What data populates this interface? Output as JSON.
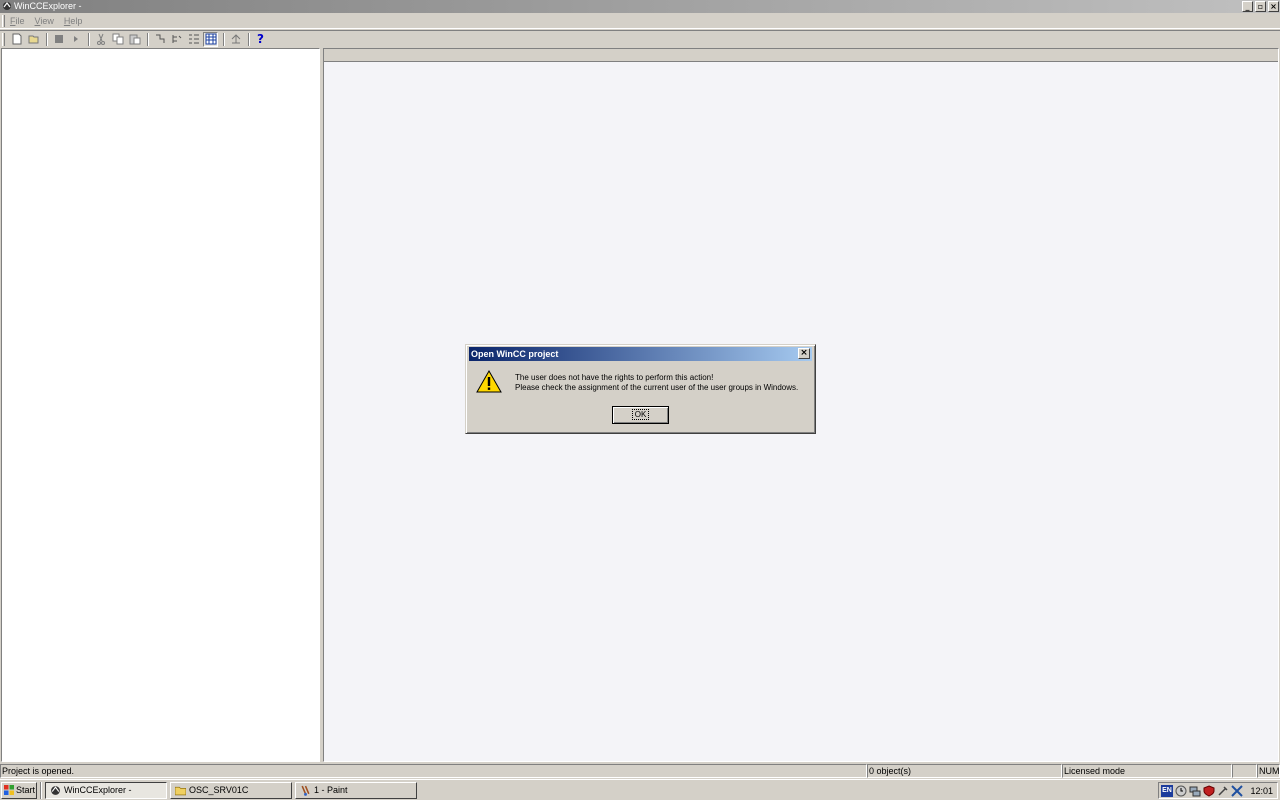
{
  "window": {
    "title": "WinCCExplorer -",
    "buttons": {
      "minimize": "_",
      "maximize": "▫",
      "close": "×"
    }
  },
  "menu": {
    "items": [
      {
        "accel": "F",
        "rest": "ile"
      },
      {
        "accel": "V",
        "rest": "iew"
      },
      {
        "accel": "H",
        "rest": "elp"
      }
    ]
  },
  "toolbar": {
    "icons": [
      "new-icon",
      "open-icon",
      "stop-icon",
      "run-icon",
      "cut-icon",
      "copy-icon",
      "paste-icon",
      "properties-icon",
      "tree-icon",
      "list-icon",
      "details-icon",
      "up-icon",
      "help-icon"
    ],
    "help_label": "?"
  },
  "dialog": {
    "title": "Open WinCC project",
    "close_label": "×",
    "message_line1": "The user does not have the rights to perform this action!",
    "message_line2": "Please check the assignment of the current user of the user groups in Windows.",
    "ok_label": "OK"
  },
  "statusbar": {
    "message": "Project is opened.",
    "objects": "0 object(s)",
    "mode": "Licensed mode",
    "num": "NUM"
  },
  "taskbar": {
    "start_label": "Start",
    "tasks": [
      {
        "label": "WinCCExplorer -",
        "icon": "wincc-icon",
        "active": true
      },
      {
        "label": "OSC_SRV01C",
        "icon": "folder-icon",
        "active": false
      },
      {
        "label": "1 - Paint",
        "icon": "paint-icon",
        "active": false
      }
    ],
    "tray_lang": "EN",
    "clock": "12:01"
  }
}
